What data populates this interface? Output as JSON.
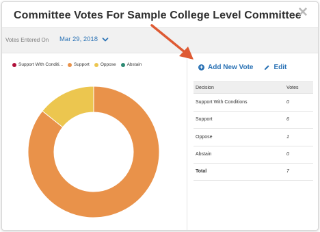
{
  "modal": {
    "title": "Committee Votes For Sample College Level Committee",
    "close_symbol": "✕"
  },
  "date_bar": {
    "label": "Votes Entered On",
    "value": "Mar 29, 2018"
  },
  "actions": {
    "add_label": "Add New Vote",
    "edit_label": "Edit"
  },
  "table": {
    "headers": {
      "decision": "Decision",
      "votes": "Votes"
    },
    "rows": [
      {
        "decision": "Support With Conditions",
        "votes": "0"
      },
      {
        "decision": "Support",
        "votes": "6"
      },
      {
        "decision": "Oppose",
        "votes": "1"
      },
      {
        "decision": "Abstain",
        "votes": "0"
      }
    ],
    "total": {
      "label": "Total",
      "votes": "7"
    }
  },
  "chart_data": {
    "type": "pie",
    "categories": [
      "Support With Conditi...",
      "Support",
      "Oppose",
      "Abstain"
    ],
    "values": [
      0,
      6,
      1,
      0
    ],
    "colors": [
      "#b0103a",
      "#e9924a",
      "#ecc64f",
      "#2d8a73"
    ],
    "legend": "top-left"
  }
}
